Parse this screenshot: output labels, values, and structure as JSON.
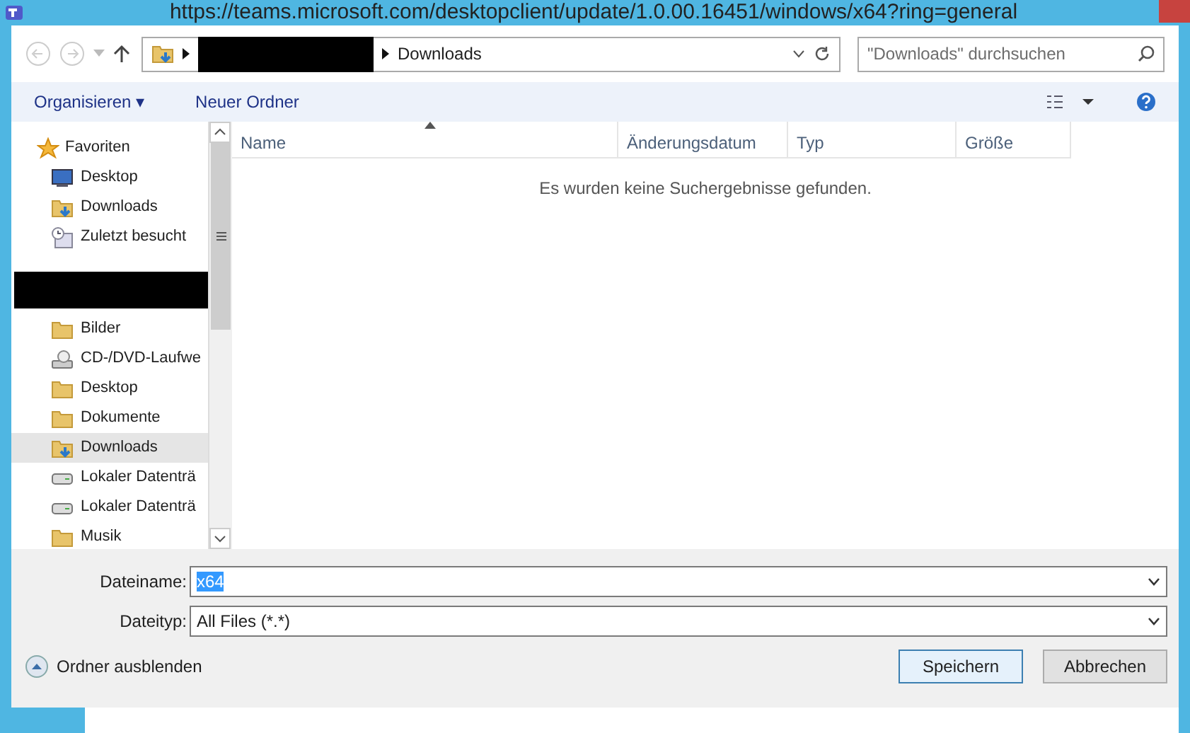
{
  "window": {
    "title": "https://teams.microsoft.com/desktopclient/update/1.0.00.16451/windows/x64?ring=general"
  },
  "address_bar": {
    "path": [
      "Downloads"
    ],
    "redacted_segment": true
  },
  "search": {
    "placeholder": "\"Downloads\" durchsuchen"
  },
  "toolbar": {
    "organize": "Organisieren ▾",
    "new_folder": "Neuer Ordner"
  },
  "sidebar": {
    "items": [
      {
        "label": "Favoriten",
        "kind": "star",
        "children": [
          {
            "label": "Desktop",
            "kind": "monitor",
            "selected": false
          },
          {
            "label": "Downloads",
            "kind": "download-folder",
            "selected": false
          },
          {
            "label": "Zuletzt besucht",
            "kind": "recent",
            "selected": false
          }
        ]
      },
      {
        "kind": "redacted",
        "children": [
          {
            "label": "Bilder",
            "kind": "folder",
            "selected": false
          },
          {
            "label": "CD-/DVD-Laufwe",
            "kind": "disc-drive",
            "selected": false
          },
          {
            "label": "Desktop",
            "kind": "folder",
            "selected": false
          },
          {
            "label": "Dokumente",
            "kind": "folder",
            "selected": false
          },
          {
            "label": "Downloads",
            "kind": "download-folder",
            "selected": true
          },
          {
            "label": "Lokaler Datenträ",
            "kind": "drive",
            "selected": false
          },
          {
            "label": "Lokaler Datenträ",
            "kind": "drive",
            "selected": false
          },
          {
            "label": "Musik",
            "kind": "folder",
            "selected": false
          }
        ]
      }
    ]
  },
  "table": {
    "columns": [
      {
        "label": "Name",
        "sorted": true
      },
      {
        "label": "Änderungsdatum",
        "sorted": false
      },
      {
        "label": "Typ",
        "sorted": false
      },
      {
        "label": "Größe",
        "sorted": false
      }
    ],
    "empty_message": "Es wurden keine Suchergebnisse gefunden."
  },
  "form": {
    "filename_label": "Dateiname:",
    "filename_value": "x64",
    "filename_selected": true,
    "filetype_label": "Dateityp:",
    "filetype_value": "All Files (*.*)"
  },
  "footer": {
    "hide_folders": "Ordner ausblenden",
    "buttons": [
      {
        "label": "Speichern",
        "default": true
      },
      {
        "label": "Abbrechen",
        "default": false
      }
    ]
  }
}
